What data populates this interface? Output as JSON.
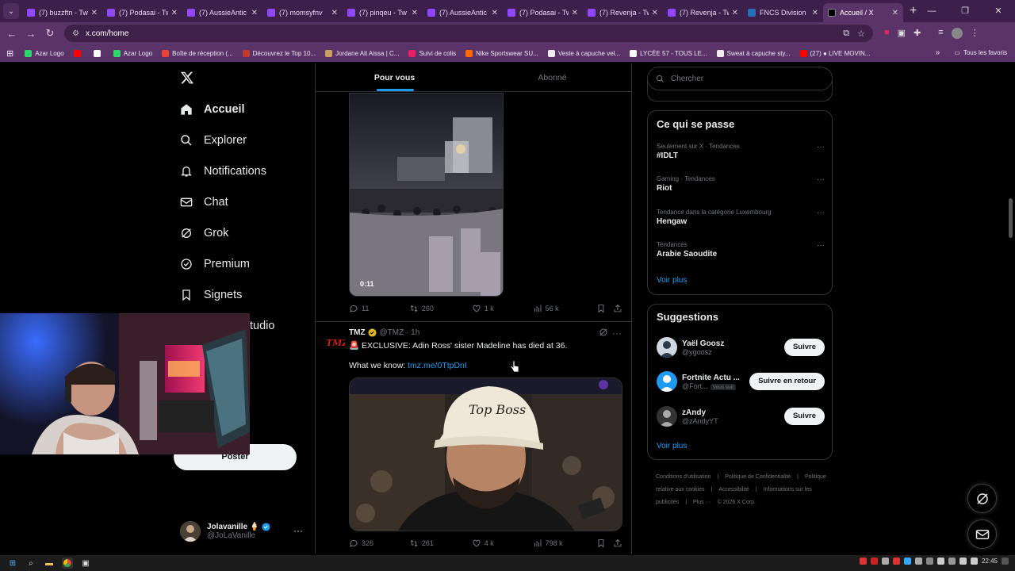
{
  "browser": {
    "tabs": [
      {
        "title": "(7) buzzftn - Tw",
        "color": "#9146ff"
      },
      {
        "title": "(7) Podasai - Tw",
        "color": "#9146ff"
      },
      {
        "title": "(7) AussieAntic",
        "color": "#9146ff"
      },
      {
        "title": "(7) momsyfnv",
        "color": "#9146ff"
      },
      {
        "title": "(7) pinqeu - Tw",
        "color": "#9146ff"
      },
      {
        "title": "(7) AussieAntic",
        "color": "#9146ff"
      },
      {
        "title": "(7) Podasai - Tw",
        "color": "#9146ff"
      },
      {
        "title": "(7) Revenja - Tw",
        "color": "#9146ff"
      },
      {
        "title": "(7) Revenja - Tw",
        "color": "#9146ff"
      },
      {
        "title": "FNCS Division",
        "color": "#2a6fb5"
      },
      {
        "title": "Accueil / X",
        "color": "#000000",
        "active": true
      }
    ],
    "url": "x.com/home",
    "bookmarks": [
      {
        "label": "Azar Logo",
        "color": "#2bd96b"
      },
      {
        "label": "",
        "color": "#ff0000"
      },
      {
        "label": "",
        "color": "#ffffff"
      },
      {
        "label": "Azar Logo",
        "color": "#2bd96b"
      },
      {
        "label": "Boîte de réception (...",
        "color": "#ea4335"
      },
      {
        "label": "Découvrez le Top 10...",
        "color": "#c0392b"
      },
      {
        "label": "Jordane Ait Aissa | C...",
        "color": "#c8a060"
      },
      {
        "label": "Suivi de colis",
        "color": "#e91e63"
      },
      {
        "label": "Nike Sportswear SU...",
        "color": "#ff6a00"
      },
      {
        "label": "Veste à capuche vel...",
        "color": "#eeeeee"
      },
      {
        "label": "LYCÉE 57 - TOUS LE...",
        "color": "#ffffff"
      },
      {
        "label": "Sweat à capuche sty...",
        "color": "#eeeeee"
      },
      {
        "label": "(27) ● LIVE MOVIN...",
        "color": "#ff0000"
      }
    ],
    "all_bookmarks": "Tous les favoris"
  },
  "sidebar": {
    "items": [
      {
        "label": "Accueil",
        "icon": "home-icon"
      },
      {
        "label": "Explorer",
        "icon": "search-icon"
      },
      {
        "label": "Notifications",
        "icon": "bell-icon"
      },
      {
        "label": "Chat",
        "icon": "mail-icon"
      },
      {
        "label": "Grok",
        "icon": "grok-icon"
      },
      {
        "label": "Premium",
        "icon": "verified-icon"
      },
      {
        "label": "Signets",
        "icon": "bookmark-icon"
      },
      {
        "label": "tudio",
        "icon": ""
      }
    ],
    "post_label": "Poster",
    "account": {
      "name": "Jolavanille 🍦",
      "handle": "@JoLaVanille"
    }
  },
  "timeline": {
    "tabs": [
      "Pour vous",
      "Abonné"
    ],
    "video_tweet": {
      "duration": "0:11",
      "replies": "11",
      "reposts": "260",
      "likes": "1 k",
      "views": "56 k"
    },
    "tmz_tweet": {
      "name": "TMZ",
      "handle": "@TMZ · 1h",
      "text": "🚨 EXCLUSIVE: Adin Ross' sister Madeline has died at 36.",
      "text2_prefix": "What we know: ",
      "link": "tmz.me/0TtpDnI",
      "cap_text": "Top Boss",
      "replies": "326",
      "reposts": "261",
      "likes": "4 k",
      "views": "798 k"
    }
  },
  "right": {
    "search_placeholder": "Chercher",
    "trends_title": "Ce qui se passe",
    "trends": [
      {
        "meta": "Seulement sur X · Tendances",
        "name": "#IDLT"
      },
      {
        "meta": "Gaming · Tendances",
        "name": "Riot"
      },
      {
        "meta": "Tendance dans la catégorie Luxembourg",
        "name": "Hengaw"
      },
      {
        "meta": "Tendances",
        "name": "Arabie Saoudite"
      }
    ],
    "voir_plus": "Voir plus",
    "suggestions_title": "Suggestions",
    "suggestions": [
      {
        "name": "Yaël Goosz",
        "handle": "@ygoosz",
        "button": "Suivre",
        "badge": ""
      },
      {
        "name": "Fortnite Actu ...",
        "handle": "@Fort...",
        "button": "Suivre en retour",
        "badge": "Vous suit"
      },
      {
        "name": "zAndy",
        "handle": "@zAndyYT",
        "button": "Suivre",
        "badge": ""
      }
    ],
    "footer": [
      "Conditions d'utilisation",
      "|",
      "Politique de Confidentialité",
      "|",
      "Politique relative aux cookies",
      "|",
      "Accessibilité",
      "|",
      "Informations sur les publicités",
      "|",
      "Plus ···",
      "© 2026 X Corp."
    ]
  },
  "taskbar": {
    "time": "22:45"
  }
}
